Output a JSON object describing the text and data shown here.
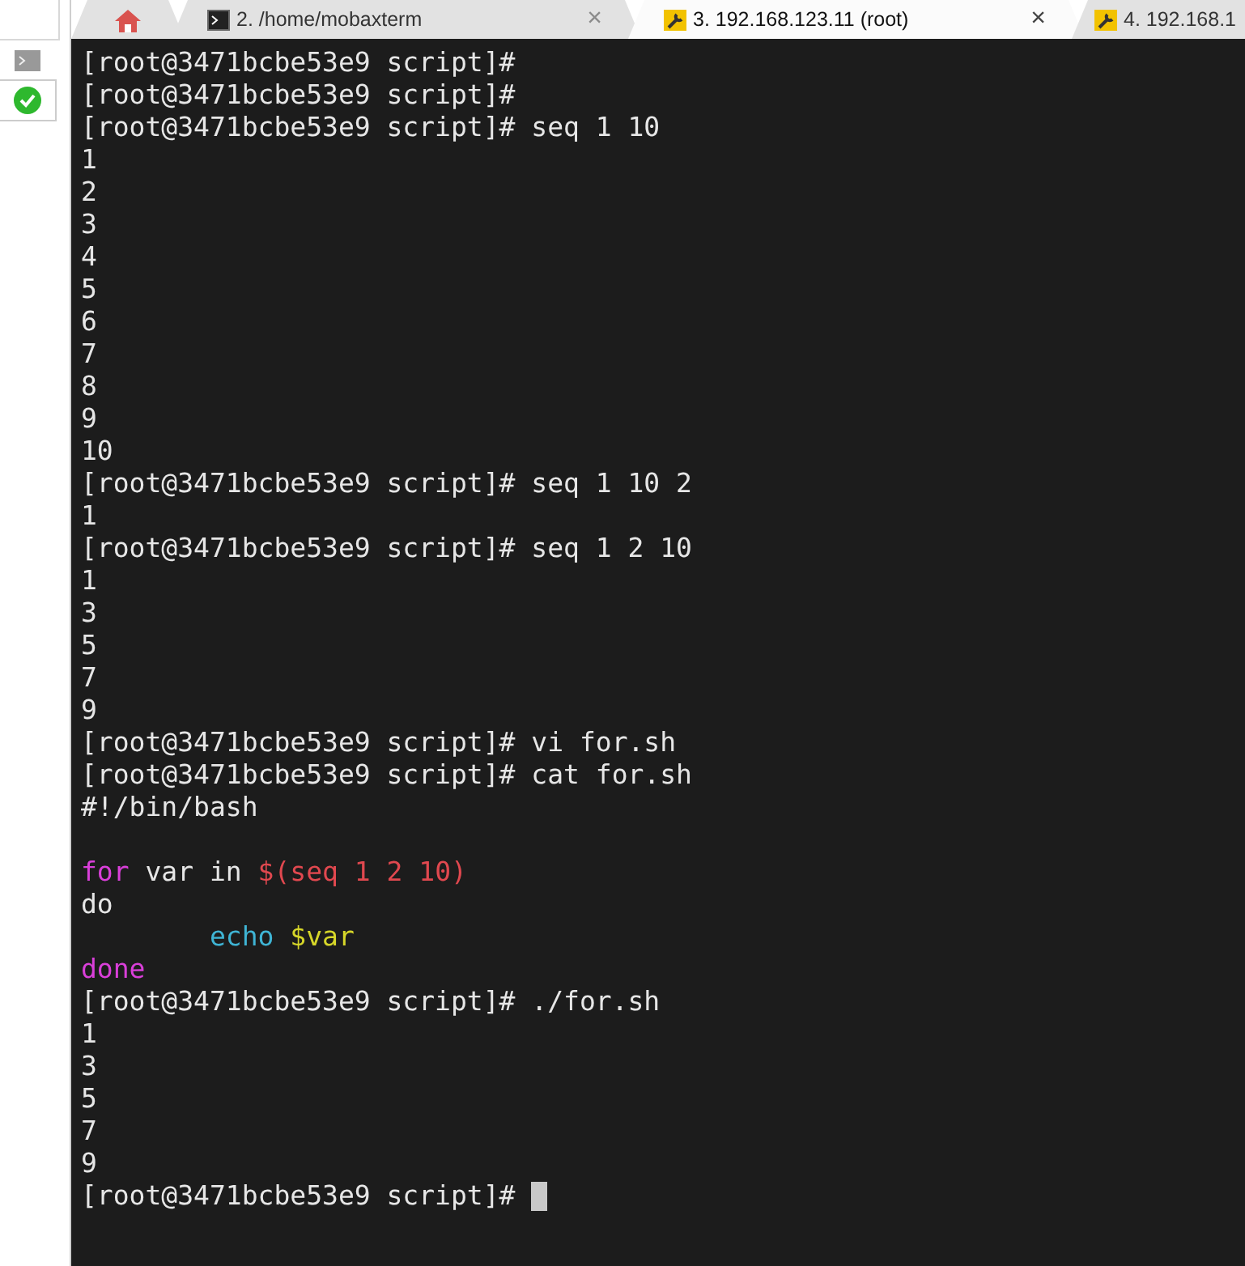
{
  "tabs": [
    {
      "kind": "home",
      "selected": false
    },
    {
      "kind": "local",
      "label": "2. /home/mobaxterm",
      "close": "×",
      "selected": false
    },
    {
      "kind": "ssh",
      "label": "3. 192.168.123.11 (root)",
      "close": "×",
      "selected": true
    },
    {
      "kind": "ssh",
      "label": "4. 192.168.1",
      "selected": false
    }
  ],
  "sidebar": {
    "items": [
      {
        "kind": "terminal"
      },
      {
        "kind": "check",
        "selected": true
      }
    ]
  },
  "terminal": {
    "cursor": true,
    "blocks": [
      {
        "lines": [
          {
            "segments": [
              {
                "text": "[root@3471bcbe53e9 script]#",
                "color": "#e6e6e6"
              }
            ]
          },
          {
            "segments": [
              {
                "text": "[root@3471bcbe53e9 script]#",
                "color": "#e6e6e6"
              }
            ]
          },
          {
            "segments": [
              {
                "text": "[root@3471bcbe53e9 script]# seq 1 10",
                "color": "#e6e6e6"
              }
            ]
          },
          {
            "segments": [
              {
                "text": "1",
                "color": "#e6e6e6"
              }
            ]
          },
          {
            "segments": [
              {
                "text": "2",
                "color": "#e6e6e6"
              }
            ]
          },
          {
            "segments": [
              {
                "text": "3",
                "color": "#e6e6e6"
              }
            ]
          },
          {
            "segments": [
              {
                "text": "4",
                "color": "#e6e6e6"
              }
            ]
          },
          {
            "segments": [
              {
                "text": "5",
                "color": "#e6e6e6"
              }
            ]
          },
          {
            "segments": [
              {
                "text": "6",
                "color": "#e6e6e6"
              }
            ]
          },
          {
            "segments": [
              {
                "text": "7",
                "color": "#e6e6e6"
              }
            ]
          },
          {
            "segments": [
              {
                "text": "8",
                "color": "#e6e6e6"
              }
            ]
          },
          {
            "segments": [
              {
                "text": "9",
                "color": "#e6e6e6"
              }
            ]
          },
          {
            "segments": [
              {
                "text": "10",
                "color": "#e6e6e6"
              }
            ]
          },
          {
            "segments": [
              {
                "text": "[root@3471bcbe53e9 script]# seq 1 10 2",
                "color": "#e6e6e6"
              }
            ]
          },
          {
            "segments": [
              {
                "text": "1",
                "color": "#e6e6e6"
              }
            ]
          },
          {
            "segments": [
              {
                "text": "[root@3471bcbe53e9 script]# seq 1 2 10",
                "color": "#e6e6e6"
              }
            ]
          },
          {
            "segments": [
              {
                "text": "1",
                "color": "#e6e6e6"
              }
            ]
          },
          {
            "segments": [
              {
                "text": "3",
                "color": "#e6e6e6"
              }
            ]
          },
          {
            "segments": [
              {
                "text": "5",
                "color": "#e6e6e6"
              }
            ]
          },
          {
            "segments": [
              {
                "text": "7",
                "color": "#e6e6e6"
              }
            ]
          },
          {
            "segments": [
              {
                "text": "9",
                "color": "#e6e6e6"
              }
            ]
          },
          {
            "segments": [
              {
                "text": "[root@3471bcbe53e9 script]# vi for.sh",
                "color": "#e6e6e6"
              }
            ]
          },
          {
            "segments": [
              {
                "text": "[root@3471bcbe53e9 script]# cat for.sh",
                "color": "#e6e6e6"
              }
            ]
          },
          {
            "segments": [
              {
                "text": "#!/bin/bash",
                "color": "#e6e6e6"
              }
            ]
          }
        ]
      },
      {
        "lines": [
          {
            "segments": [
              {
                "text": "for",
                "color": "#d93fd9"
              },
              {
                "text": " var in ",
                "color": "#e6e6e6"
              },
              {
                "text": "$(seq 1 2 10)",
                "color": "#e0484f"
              }
            ]
          },
          {
            "segments": [
              {
                "text": "do",
                "color": "#e6e6e6"
              }
            ]
          },
          {
            "segments": [
              {
                "text": "        echo ",
                "color": "#3fb4d4"
              },
              {
                "text": "$var",
                "color": "#d6d629"
              }
            ]
          },
          {
            "segments": [
              {
                "text": "done",
                "color": "#d93fd9"
              }
            ]
          },
          {
            "segments": [
              {
                "text": "[root@3471bcbe53e9 script]# ./for.sh",
                "color": "#e6e6e6"
              }
            ]
          },
          {
            "segments": [
              {
                "text": "1",
                "color": "#e6e6e6"
              }
            ]
          },
          {
            "segments": [
              {
                "text": "3",
                "color": "#e6e6e6"
              }
            ]
          },
          {
            "segments": [
              {
                "text": "5",
                "color": "#e6e6e6"
              }
            ]
          },
          {
            "segments": [
              {
                "text": "7",
                "color": "#e6e6e6"
              }
            ]
          },
          {
            "segments": [
              {
                "text": "9",
                "color": "#e6e6e6"
              }
            ]
          },
          {
            "segments": [
              {
                "text": "[root@3471bcbe53e9 script]# ",
                "color": "#e6e6e6"
              }
            ]
          }
        ]
      }
    ]
  }
}
